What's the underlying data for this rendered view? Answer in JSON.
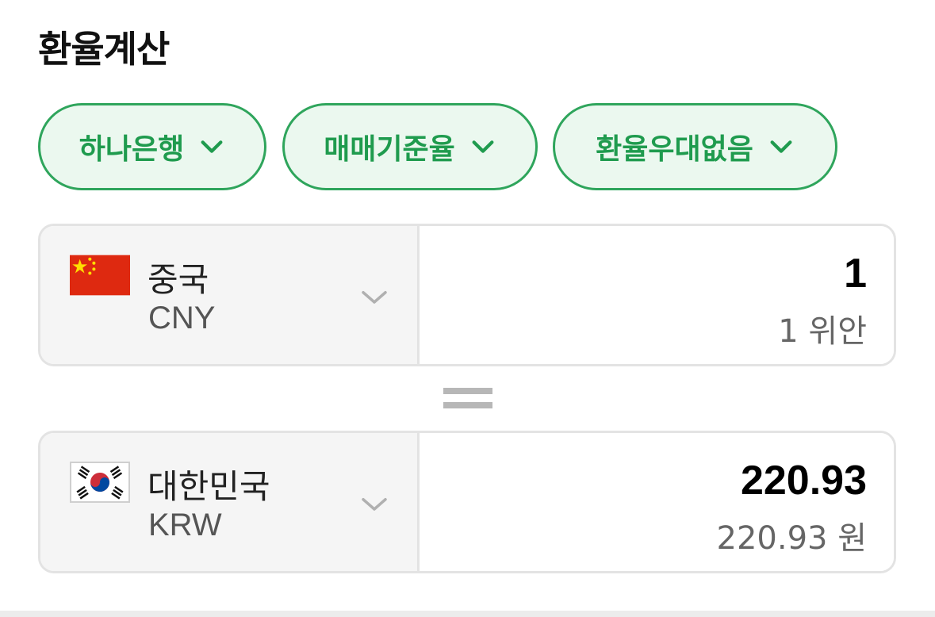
{
  "title": "환율계산",
  "filters": [
    {
      "label": "하나은행",
      "icon": "chevron-down-icon"
    },
    {
      "label": "매매기준율",
      "icon": "chevron-down-icon"
    },
    {
      "label": "환율우대없음",
      "icon": "chevron-down-icon"
    }
  ],
  "from": {
    "country": "중국",
    "code": "CNY",
    "flag_icon": "china-flag-icon",
    "amount": "1",
    "amount_text": "1 위안"
  },
  "equals_icon": "equals-icon",
  "to": {
    "country": "대한민국",
    "code": "KRW",
    "flag_icon": "south-korea-flag-icon",
    "amount": "220.93",
    "amount_text": "220.93 원"
  },
  "colors": {
    "accent_green": "#1f9b4e",
    "chip_background": "#ebf8ef",
    "china_flag_red": "#de2910",
    "china_flag_star": "#ffde00"
  }
}
